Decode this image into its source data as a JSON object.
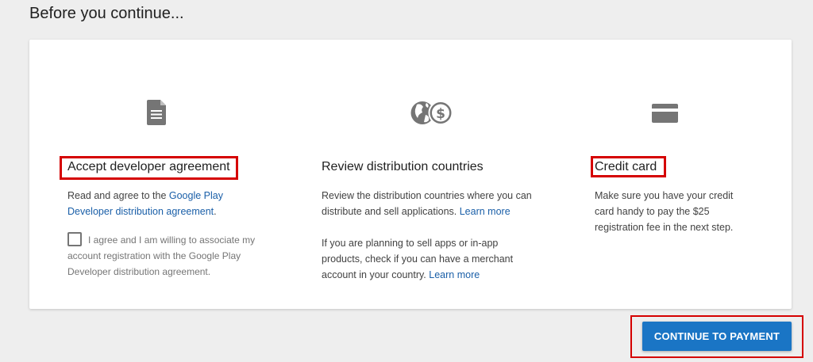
{
  "page": {
    "heading": "Before you continue..."
  },
  "columns": {
    "agreement": {
      "icon": "document-icon",
      "title": "Accept developer agreement",
      "text_prefix": "Read and agree to the ",
      "link": "Google Play Developer distribution agreement",
      "text_suffix": ".",
      "checkbox_label": "I agree and I am willing to associate my account registration with the Google Play Developer distribution agreement.",
      "checkbox_checked": false
    },
    "countries": {
      "icon": "globe-dollar-icon",
      "title": "Review distribution countries",
      "para1_text": "Review the distribution countries where you can distribute and sell applications. ",
      "para1_link": "Learn more",
      "para2_text": "If you are planning to sell apps or in-app products, check if you can have a merchant account in your country. ",
      "para2_link": "Learn more"
    },
    "credit": {
      "icon": "credit-card-icon",
      "title": "Credit card",
      "text": "Make sure you have your credit card handy to pay the $25 registration fee in the next step."
    }
  },
  "actions": {
    "continue_label": "CONTINUE TO PAYMENT"
  },
  "colors": {
    "highlight": "#d50000",
    "button": "#1a75c5",
    "link": "#1a5fa8",
    "icon": "#757575"
  }
}
